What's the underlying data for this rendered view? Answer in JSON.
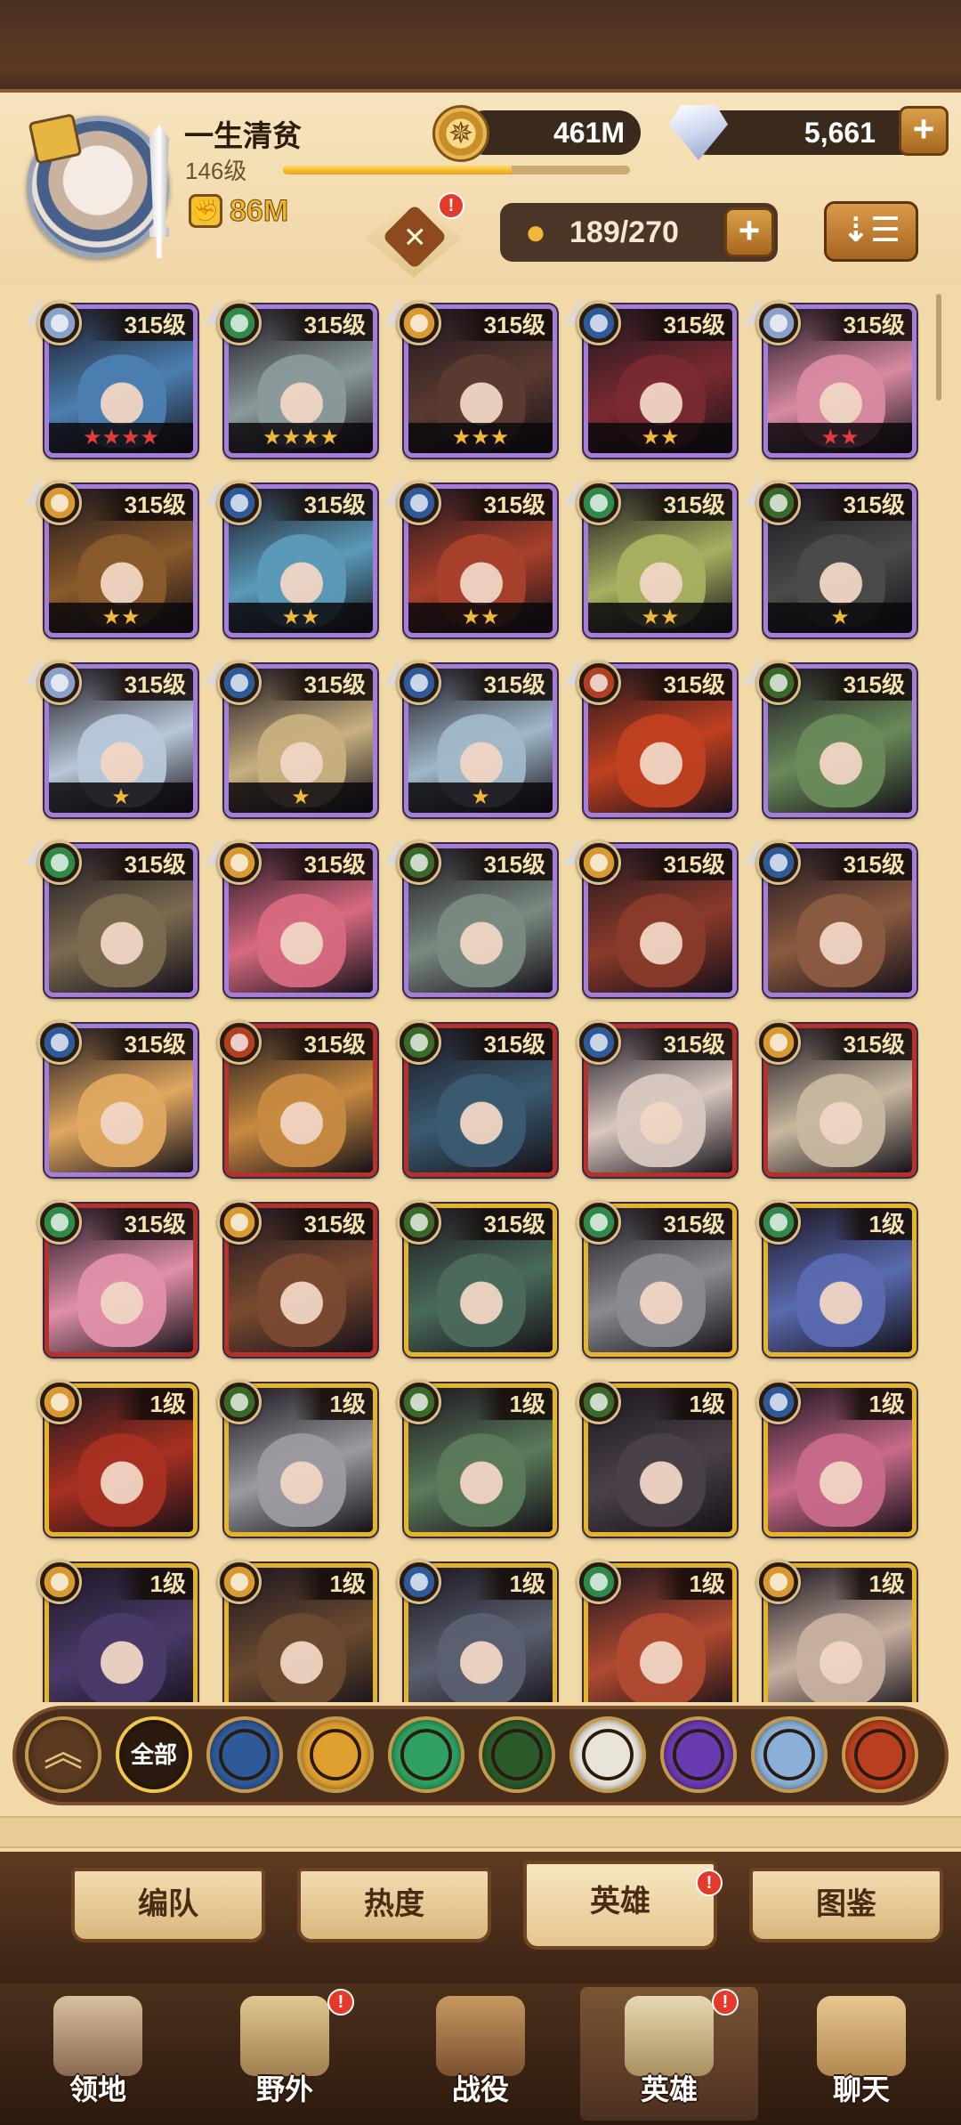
{
  "player": {
    "name": "一生清贫",
    "level": "146级",
    "power": "86M",
    "xp_progress": 0.66
  },
  "resources": {
    "gold": "461M",
    "gems": "5,661"
  },
  "hero_count": "189/270",
  "badge_alert": "!",
  "heroes": [
    {
      "level": "315级",
      "stars": "★★★★",
      "frame": "purple",
      "faction": "celestial",
      "star_color": "red",
      "art": "#4b7fb0"
    },
    {
      "level": "315级",
      "stars": "★★★★",
      "frame": "purple",
      "faction": "wilder",
      "star_color": "gold",
      "art": "#8a9a9a"
    },
    {
      "level": "315级",
      "stars": "★★★",
      "frame": "purple",
      "faction": "graveborn",
      "star_color": "gold",
      "art": "#5a3a30"
    },
    {
      "level": "315级",
      "stars": "★★",
      "frame": "purple",
      "faction": "lightbearer",
      "star_color": "gold",
      "art": "#7a2a30"
    },
    {
      "level": "315级",
      "stars": "★★",
      "frame": "purple",
      "faction": "celestial",
      "star_color": "red",
      "art": "#d88aa0"
    },
    {
      "level": "315级",
      "stars": "★★",
      "frame": "purple",
      "faction": "graveborn",
      "star_color": "gold",
      "art": "#8a5a2a"
    },
    {
      "level": "315级",
      "stars": "★★",
      "frame": "purple",
      "faction": "lightbearer",
      "star_color": "gold",
      "art": "#5a9ab8"
    },
    {
      "level": "315级",
      "stars": "★★",
      "frame": "purple",
      "faction": "lightbearer",
      "star_color": "gold",
      "art": "#a8402a"
    },
    {
      "level": "315级",
      "stars": "★★",
      "frame": "purple",
      "faction": "wilder",
      "star_color": "gold",
      "art": "#a8b060"
    },
    {
      "level": "315级",
      "stars": "★",
      "frame": "purple",
      "faction": "mauler",
      "star_color": "gold",
      "art": "#4a4a48"
    },
    {
      "level": "315级",
      "stars": "★",
      "frame": "purple",
      "faction": "celestial",
      "star_color": "gold",
      "art": "#b8c8d8"
    },
    {
      "level": "315级",
      "stars": "★",
      "frame": "purple",
      "faction": "lightbearer",
      "star_color": "gold",
      "art": "#c8b080"
    },
    {
      "level": "315级",
      "stars": "★",
      "frame": "purple",
      "faction": "lightbearer",
      "star_color": "gold",
      "art": "#a0b8c8"
    },
    {
      "level": "315级",
      "stars": "",
      "frame": "purple",
      "faction": "hypogean",
      "star_color": "gold",
      "art": "#c04020"
    },
    {
      "level": "315级",
      "stars": "",
      "frame": "purple",
      "faction": "mauler",
      "star_color": "gold",
      "art": "#6a8a5a"
    },
    {
      "level": "315级",
      "stars": "",
      "frame": "purple",
      "faction": "wilder",
      "star_color": "gold",
      "art": "#7a6a50"
    },
    {
      "level": "315级",
      "stars": "",
      "frame": "purple",
      "faction": "graveborn",
      "star_color": "gold",
      "art": "#d86a80"
    },
    {
      "level": "315级",
      "stars": "",
      "frame": "purple",
      "faction": "mauler",
      "star_color": "gold",
      "art": "#7a8a80"
    },
    {
      "level": "315级",
      "stars": "",
      "frame": "purple",
      "faction": "graveborn",
      "star_color": "gold",
      "art": "#8a3a2a"
    },
    {
      "level": "315级",
      "stars": "",
      "frame": "purple",
      "faction": "lightbearer",
      "star_color": "gold",
      "art": "#8a5a40"
    },
    {
      "level": "315级",
      "stars": "",
      "frame": "purple",
      "faction": "lightbearer",
      "star_color": "gold",
      "art": "#e0a860"
    },
    {
      "level": "315级",
      "stars": "",
      "frame": "red",
      "faction": "hypogean",
      "star_color": "gold",
      "art": "#c88a40"
    },
    {
      "level": "315级",
      "stars": "",
      "frame": "red",
      "faction": "mauler",
      "star_color": "gold",
      "art": "#3a5a70"
    },
    {
      "level": "315级",
      "stars": "",
      "frame": "red",
      "faction": "lightbearer",
      "star_color": "gold",
      "art": "#d8c8c0"
    },
    {
      "level": "315级",
      "stars": "",
      "frame": "red",
      "faction": "graveborn",
      "star_color": "gold",
      "art": "#c8b8a0"
    },
    {
      "level": "315级",
      "stars": "",
      "frame": "red",
      "faction": "wilder",
      "star_color": "gold",
      "art": "#e090a8"
    },
    {
      "level": "315级",
      "stars": "",
      "frame": "red",
      "faction": "graveborn",
      "star_color": "gold",
      "art": "#7a4a30"
    },
    {
      "level": "315级",
      "stars": "",
      "frame": "gold",
      "faction": "mauler",
      "star_color": "gold",
      "art": "#4a6a5a"
    },
    {
      "level": "315级",
      "stars": "",
      "frame": "gold",
      "faction": "wilder",
      "star_color": "gold",
      "art": "#8a8a90"
    },
    {
      "level": "1级",
      "stars": "",
      "frame": "gold",
      "faction": "wilder",
      "star_color": "gold",
      "art": "#5a6ab0"
    },
    {
      "level": "1级",
      "stars": "",
      "frame": "gold",
      "faction": "graveborn",
      "star_color": "gold",
      "art": "#a83020"
    },
    {
      "level": "1级",
      "stars": "",
      "frame": "gold",
      "faction": "mauler",
      "star_color": "gold",
      "art": "#9a9aa0"
    },
    {
      "level": "1级",
      "stars": "",
      "frame": "gold",
      "faction": "mauler",
      "star_color": "gold",
      "art": "#5a7a5a"
    },
    {
      "level": "1级",
      "stars": "",
      "frame": "gold",
      "faction": "mauler",
      "star_color": "gold",
      "art": "#4a4048"
    },
    {
      "level": "1级",
      "stars": "",
      "frame": "gold",
      "faction": "lightbearer",
      "star_color": "gold",
      "art": "#c86a8a"
    },
    {
      "level": "1级",
      "stars": "",
      "frame": "gold",
      "faction": "graveborn",
      "star_color": "gold",
      "art": "#4a3a6a"
    },
    {
      "level": "1级",
      "stars": "",
      "frame": "gold",
      "faction": "graveborn",
      "star_color": "gold",
      "art": "#6a4a30"
    },
    {
      "level": "1级",
      "stars": "",
      "frame": "gold",
      "faction": "lightbearer",
      "star_color": "gold",
      "art": "#5a6070"
    },
    {
      "level": "1级",
      "stars": "",
      "frame": "gold",
      "faction": "wilder",
      "star_color": "gold",
      "art": "#b04a30"
    },
    {
      "level": "1级",
      "stars": "",
      "frame": "gold",
      "faction": "graveborn",
      "star_color": "gold",
      "art": "#c8b0a0"
    }
  ],
  "faction_colors": {
    "celestial": "#8aa0c8",
    "wilder": "#2f8a4a",
    "graveborn": "#d89a30",
    "lightbearer": "#2f5a9a",
    "mauler": "#3a6a2a",
    "hypogean": "#b04020"
  },
  "filters": {
    "collapse_icon": "chevron-up-icon",
    "all_label": "全部",
    "faction_icons": [
      {
        "name": "lightbearer-filter-icon",
        "color": "#2f5a9a"
      },
      {
        "name": "graveborn-filter-icon",
        "color": "#e0a030"
      },
      {
        "name": "wilder-filter-icon",
        "color": "#2fa060"
      },
      {
        "name": "mauler-filter-icon",
        "color": "#2a5a2a"
      },
      {
        "name": "celestial-filter-icon",
        "color": "#e8e4da"
      },
      {
        "name": "hypogean-filter-icon",
        "color": "#6a3ab0"
      },
      {
        "name": "dimensional-filter-icon",
        "color": "#8ab0d8"
      },
      {
        "name": "draconis-filter-icon",
        "color": "#b84020"
      }
    ]
  },
  "tabs": {
    "formation": "编队",
    "popularity": "热度",
    "heroes": "英雄",
    "codex": "图鉴"
  },
  "nav": {
    "territory": "领地",
    "wilds": "野外",
    "battle": "战役",
    "heroes": "英雄",
    "chat": "聊天"
  },
  "alerts": {
    "heroes_tab": "!",
    "wilds": "!",
    "heroes_nav": "!"
  }
}
